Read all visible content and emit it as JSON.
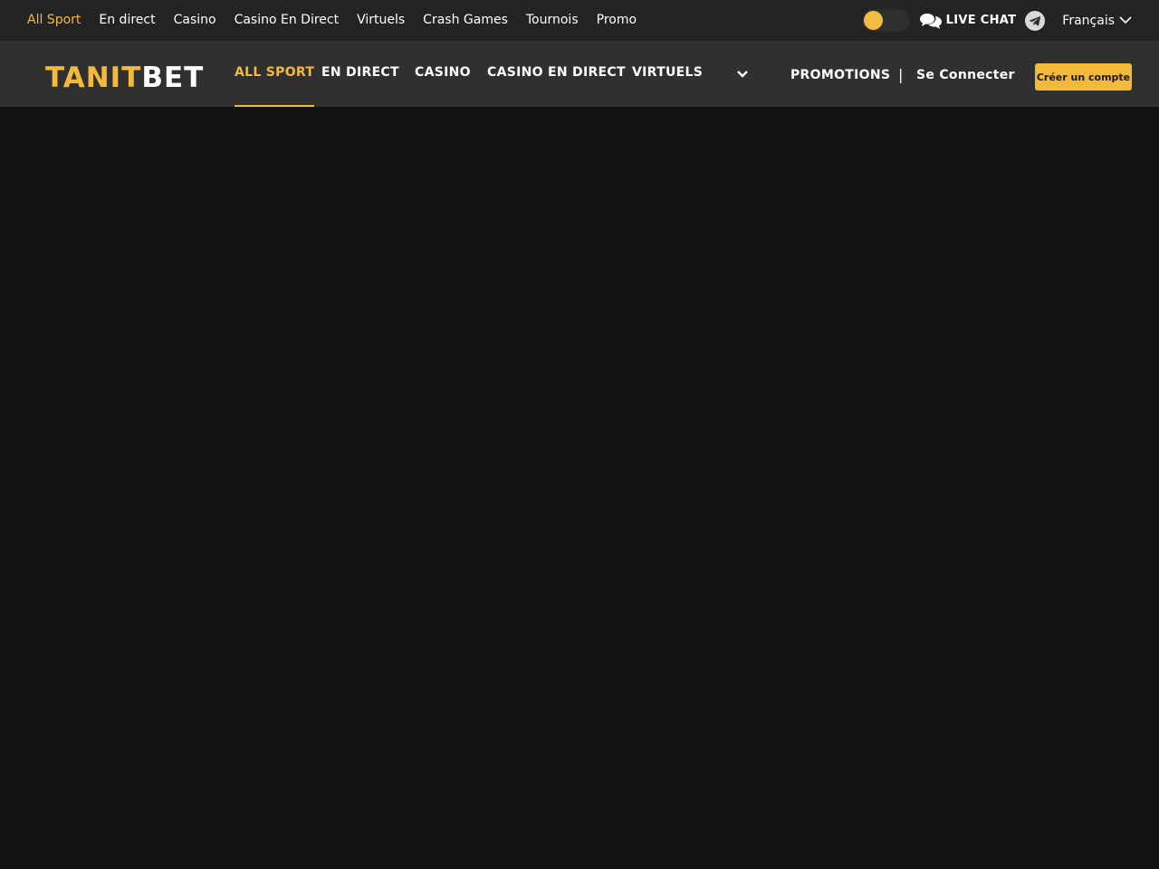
{
  "topbar": {
    "links": [
      "All Sport",
      "En direct",
      "Casino",
      "Casino En Direct",
      "Virtuels",
      "Crash Games",
      "Tournois",
      "Promo"
    ],
    "active_index": 0,
    "live_chat_label": "LIVE CHAT",
    "language": "Français",
    "theme_toggle_on": false
  },
  "header": {
    "logo_part1": "TANIT",
    "logo_part2": "BET",
    "nav": [
      "ALL SPORT",
      "EN DIRECT",
      "CASINO",
      "CASINO EN DIRECT",
      "VIRTUELS"
    ],
    "active_index": 0,
    "promotions_label": "PROMOTIONS",
    "separator": "|",
    "login_label": "Se Connecter",
    "signup_label": "Créer un compte"
  },
  "colors": {
    "accent": "#f3b93a",
    "topbar_bg": "#232323",
    "header_bg": "#303030",
    "page_bg": "#141312"
  },
  "icons": {
    "chat": "chat-bubbles-icon",
    "telegram": "telegram-icon",
    "language_chevron": "chevron-down-icon",
    "more_nav": "chevron-down-icon"
  }
}
